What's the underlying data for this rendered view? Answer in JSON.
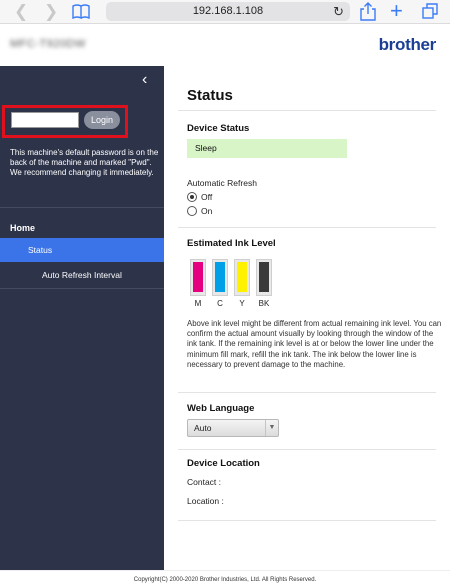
{
  "browser": {
    "url": "192.168.1.108",
    "icons": [
      "chevron-left-icon",
      "chevron-right-icon",
      "bookmarks-icon",
      "reload-icon",
      "share-icon",
      "plus-icon",
      "tabs-icon"
    ],
    "accent_color": "#3b7cf5"
  },
  "header": {
    "model_name": "MFC-T920DW",
    "logo_text": "brother",
    "logo_color": "#1c3f95"
  },
  "sidebar": {
    "collapse_glyph": "‹",
    "password_value": "",
    "login_label": "Login",
    "password_note": [
      "This machine's default password is on the back of the machine and marked \"Pwd\".",
      "We recommend changing it immediately."
    ],
    "nav": {
      "home": "Home",
      "items": [
        {
          "label": "Status",
          "active": true
        },
        {
          "label": "Auto Refresh Interval",
          "active": false
        }
      ]
    },
    "background_color": "#2d3349",
    "highlight_color": "#e0101c",
    "active_color": "#3b74e8"
  },
  "main": {
    "title": "Status",
    "device_status": {
      "heading": "Device Status",
      "value": "Sleep",
      "color": "#d8f5c8"
    },
    "auto_refresh": {
      "label": "Automatic Refresh",
      "options": [
        {
          "label": "Off",
          "selected": true
        },
        {
          "label": "On",
          "selected": false
        }
      ]
    },
    "ink": {
      "heading": "Estimated Ink Level",
      "cartridges": [
        {
          "label": "M",
          "color": "#e4007f"
        },
        {
          "label": "C",
          "color": "#00a0e9"
        },
        {
          "label": "Y",
          "color": "#fff100"
        },
        {
          "label": "BK",
          "color": "#3a3a3a"
        }
      ],
      "note": "Above ink level might be different from actual remaining ink level. You can confirm the actual amount visually by looking through the window of the ink tank. If the remaining ink level is at or below the lower line under the minimum fill mark, refill the ink tank. The ink below the lower line is necessary to prevent damage to the machine."
    },
    "web_language": {
      "heading": "Web Language",
      "selected": "Auto"
    },
    "device_location": {
      "heading": "Device Location",
      "contact_label": "Contact :",
      "location_label": "Location :"
    }
  },
  "footer": {
    "copyright": "Copyright(C) 2000-2020 Brother Industries, Ltd. All Rights Reserved."
  }
}
